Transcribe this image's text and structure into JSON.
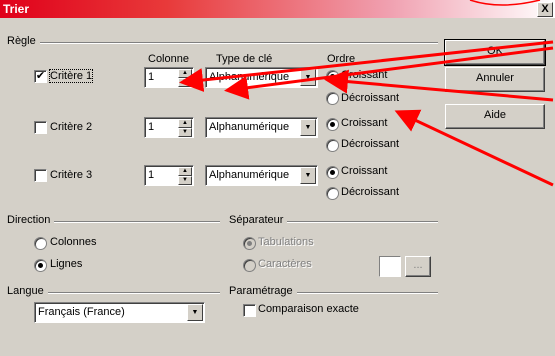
{
  "window": {
    "title": "Trier",
    "close_glyph": "X"
  },
  "regle": {
    "title": "Règle",
    "headers": {
      "colonne": "Colonne",
      "type": "Type de clé",
      "ordre": "Ordre"
    },
    "criteria": [
      {
        "label": "Critère 1",
        "checked": true,
        "colonne": "1",
        "type": "Alphanumérique",
        "asc_label": "Croissant",
        "desc_label": "Décroissant",
        "selected": "asc"
      },
      {
        "label": "Critère 2",
        "checked": false,
        "colonne": "1",
        "type": "Alphanumérique",
        "asc_label": "Croissant",
        "desc_label": "Décroissant",
        "selected": "asc"
      },
      {
        "label": "Critère 3",
        "checked": false,
        "colonne": "1",
        "type": "Alphanumérique",
        "asc_label": "Croissant",
        "desc_label": "Décroissant",
        "selected": "asc"
      }
    ]
  },
  "buttons": {
    "ok": "OK",
    "cancel": "Annuler",
    "help": "Aide"
  },
  "direction": {
    "title": "Direction",
    "columns": "Colonnes",
    "rows": "Lignes",
    "selected": "rows"
  },
  "separator": {
    "title": "Séparateur",
    "tabs": "Tabulations",
    "chars": "Caractères",
    "more": "..."
  },
  "langue": {
    "title": "Langue",
    "value": "Français (France)"
  },
  "parametrage": {
    "title": "Paramétrage",
    "exact": "Comparaison exacte",
    "exact_checked": false
  },
  "annotation_color": "#ff0000"
}
